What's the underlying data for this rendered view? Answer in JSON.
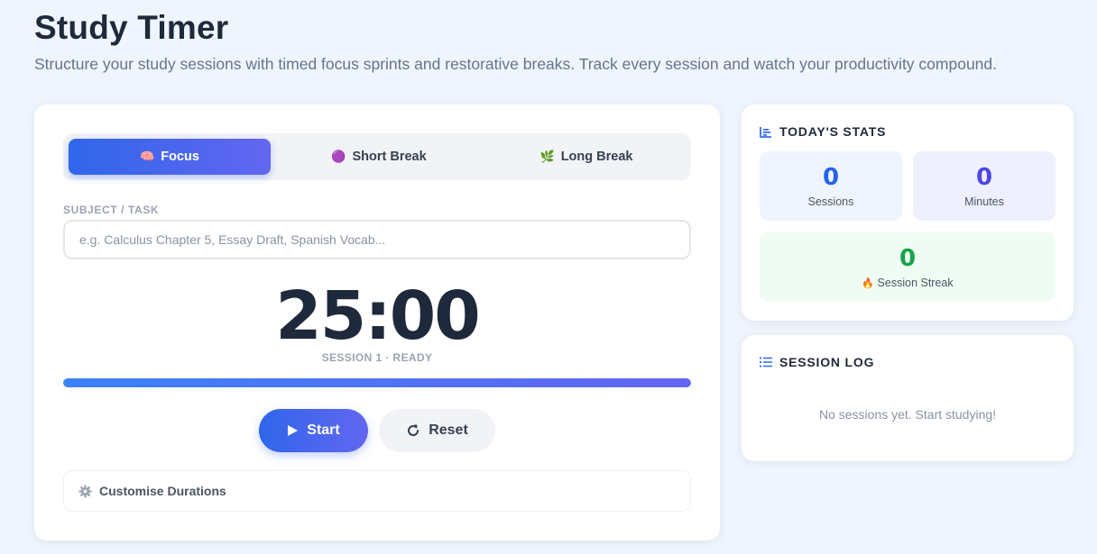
{
  "header": {
    "title": "Study Timer",
    "subtitle": "Structure your study sessions with timed focus sprints and restorative breaks. Track every session and watch your productivity compound."
  },
  "modes": [
    {
      "emoji": "🧠",
      "label": "Focus",
      "active": true
    },
    {
      "emoji": "🟣",
      "label": "Short Break",
      "active": false
    },
    {
      "emoji": "🌿",
      "label": "Long Break",
      "active": false
    }
  ],
  "task": {
    "label": "SUBJECT / TASK",
    "placeholder": "e.g. Calculus Chapter 5, Essay Draft, Spanish Vocab...",
    "value": ""
  },
  "timer": {
    "display": "25:00",
    "status": "SESSION 1 · READY",
    "progress_percent": 100
  },
  "controls": {
    "start_label": "Start",
    "reset_label": "Reset"
  },
  "customise": {
    "label": "Customise Durations"
  },
  "stats": {
    "title": "TODAY'S STATS",
    "sessions": {
      "value": "0",
      "label": "Sessions"
    },
    "minutes": {
      "value": "0",
      "label": "Minutes"
    },
    "streak": {
      "value": "0",
      "label": "Session Streak",
      "emoji": "🔥"
    }
  },
  "log": {
    "title": "SESSION LOG",
    "empty_text": "No sessions yet. Start studying!"
  },
  "colors": {
    "accent_start": "#2f66ea",
    "accent_end": "#6366f1",
    "background": "#eff5fd",
    "streak_green": "#16a34a"
  }
}
